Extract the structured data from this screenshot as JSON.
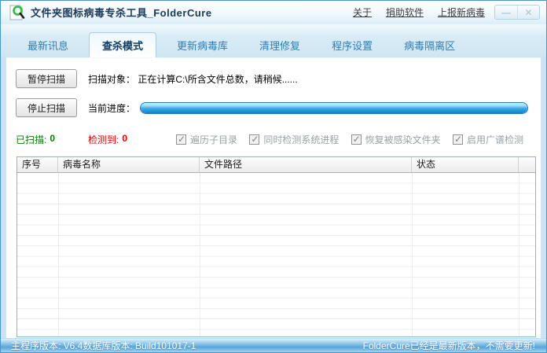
{
  "window": {
    "title": "文件夹图标病毒专杀工具_FolderCure",
    "links": [
      {
        "label": "关于"
      },
      {
        "label": "捐助软件"
      },
      {
        "label": "上报新病毒"
      }
    ],
    "controls": {
      "minimize": "—",
      "close": "✕"
    }
  },
  "tabs": [
    {
      "label": "最新讯息",
      "active": false
    },
    {
      "label": "查杀模式",
      "active": true
    },
    {
      "label": "更新病毒库",
      "active": false
    },
    {
      "label": "清理修复",
      "active": false
    },
    {
      "label": "程序设置",
      "active": false
    },
    {
      "label": "病毒隔离区",
      "active": false
    }
  ],
  "scan": {
    "pause_button": "暂停扫描",
    "stop_button": "停止扫描",
    "target_label": "扫描对象：",
    "target_value": "正在计算C:\\所含文件总数，请稍候......",
    "progress_label": "当前进度：",
    "progress_percent": 100
  },
  "stats": {
    "scanned_label": "已扫描:",
    "scanned_value": "0",
    "detected_label": "检测到:",
    "detected_value": "0"
  },
  "options": [
    {
      "label": "遍历子目录",
      "checked": true,
      "disabled": true
    },
    {
      "label": "同时检测系统进程",
      "checked": true,
      "disabled": true
    },
    {
      "label": "恢复被感染文件夹",
      "checked": true,
      "disabled": true
    },
    {
      "label": "启用广谱检测",
      "checked": true,
      "disabled": true
    }
  ],
  "table": {
    "columns": [
      {
        "label": "序号"
      },
      {
        "label": "病毒名称"
      },
      {
        "label": "文件路径"
      },
      {
        "label": "状态"
      }
    ],
    "rows": []
  },
  "statusbar": {
    "left": "主程序版本: V6.4数据库版本: Build101017-1",
    "right": "FolderCure已经是最新版本，不需要更新!"
  },
  "colors": {
    "accent_blue": "#2d7fb5",
    "title_navy": "#1b3a5c",
    "scanned_green": "#008000",
    "detected_red": "#e60000",
    "progress_blue": "#1e8fd6",
    "statusbar_blue": "#58a5d8"
  }
}
